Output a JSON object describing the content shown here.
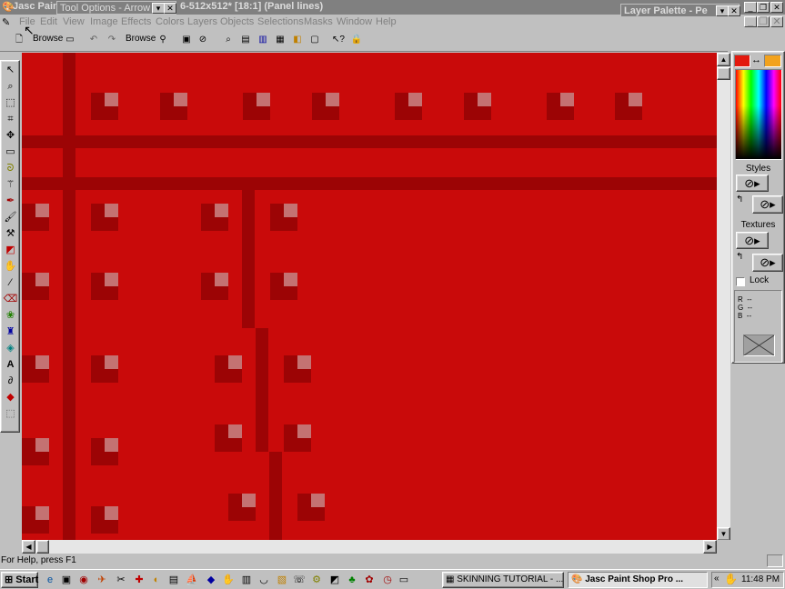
{
  "app": {
    "title": "Jasc Paint Shop Pro - ",
    "document_title": "6-512x512* [18:1] (Panel lines)"
  },
  "tool_options": {
    "title": "Tool Options - Arrow"
  },
  "layer_palette": {
    "title": "Layer Palette - Pe"
  },
  "menu": [
    "File",
    "Edit",
    "View",
    "Image",
    "Effects",
    "Colors",
    "Layers",
    "Objects",
    "Selections",
    "Masks",
    "Window",
    "Help"
  ],
  "toolbar": {
    "browse_label": "Browse",
    "icons": [
      "new-icon",
      "open-icon",
      "undo-icon",
      "redo-icon",
      "eyedropper-icon",
      "zoom-icon",
      "toolbar-palette-icon",
      "histogram-icon",
      "layers-icon",
      "overview-icon",
      "help-pointer-icon",
      "lock-icon"
    ]
  },
  "tools": [
    "arrow-tool",
    "zoom-tool",
    "deformation-tool",
    "crop-tool",
    "mover-tool",
    "selection-tool",
    "freehand-tool",
    "magic-wand-tool",
    "dropper-tool",
    "paint-brush-tool",
    "clone-brush-tool",
    "color-replacer-tool",
    "retouch-tool",
    "scratch-remover-tool",
    "eraser-tool",
    "picture-tube-tool",
    "airbrush-tool",
    "flood-fill-tool",
    "text-tool",
    "draw-tool",
    "preset-shapes-tool",
    "object-selector-tool"
  ],
  "palette": {
    "foreground_color": "#e3190e",
    "background_color": "#f2a21d",
    "styles_label": "Styles",
    "textures_label": "Textures",
    "lock_label": "Lock",
    "rgb": [
      {
        "label": "R",
        "value": "--"
      },
      {
        "label": "G",
        "value": "--"
      },
      {
        "label": "B",
        "value": "--"
      }
    ]
  },
  "status": {
    "help_text": "For Help, press F1"
  },
  "taskbar": {
    "start_label": "Start",
    "tasks": [
      {
        "label": "SKINNING TUTORIAL - ..."
      },
      {
        "label": "Jasc Paint Shop Pro ..."
      }
    ],
    "clock": "11:48 PM"
  },
  "colors": {
    "canvas": "#c90a0a",
    "panel_line": "#9c0405",
    "highlight": "#c47272",
    "title_inactive": "#808080"
  }
}
